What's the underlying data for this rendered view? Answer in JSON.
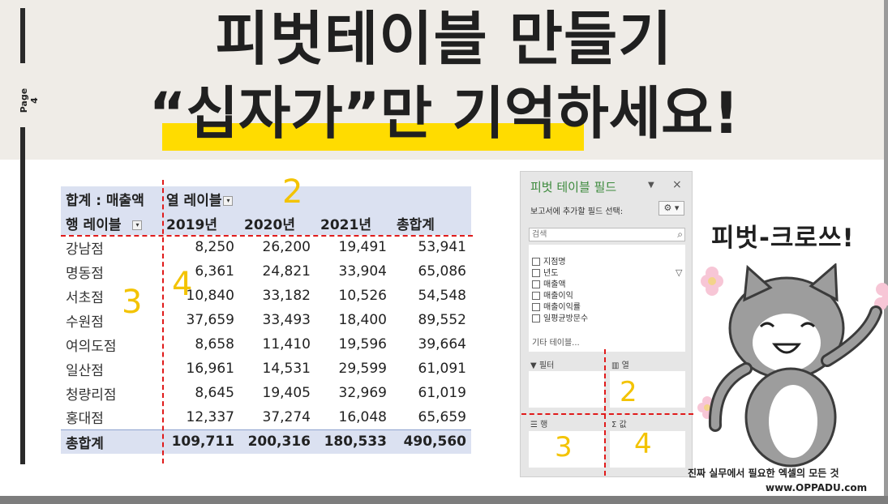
{
  "page": {
    "label": "Page 4"
  },
  "title": {
    "line1": "피벗테이블 만들기",
    "line2": "“십자가”만 기억하세요!"
  },
  "pivot_table": {
    "value_label": "합계 : 매출액",
    "column_label": "열 레이블",
    "row_label": "행 레이블",
    "years": [
      "2019년",
      "2020년",
      "2021년",
      "총합계"
    ],
    "rows": [
      {
        "name": "강남점",
        "values": [
          "8,250",
          "26,200",
          "19,491",
          "53,941"
        ]
      },
      {
        "name": "명동점",
        "values": [
          "6,361",
          "24,821",
          "33,904",
          "65,086"
        ]
      },
      {
        "name": "서초점",
        "values": [
          "10,840",
          "33,182",
          "10,526",
          "54,548"
        ]
      },
      {
        "name": "수원점",
        "values": [
          "37,659",
          "33,493",
          "18,400",
          "89,552"
        ]
      },
      {
        "name": "여의도점",
        "values": [
          "8,658",
          "11,410",
          "19,596",
          "39,664"
        ]
      },
      {
        "name": "일산점",
        "values": [
          "16,961",
          "14,531",
          "29,599",
          "61,091"
        ]
      },
      {
        "name": "청량리점",
        "values": [
          "8,645",
          "19,405",
          "32,969",
          "61,019"
        ]
      },
      {
        "name": "홍대점",
        "values": [
          "12,337",
          "37,274",
          "16,048",
          "65,659"
        ]
      }
    ],
    "total": {
      "name": "총합계",
      "values": [
        "109,711",
        "200,316",
        "180,533",
        "490,560"
      ]
    }
  },
  "annotations": {
    "col_num": "2",
    "row_num": "3",
    "val_num": "4"
  },
  "field_pane": {
    "title": "피벗 테이블 필드",
    "subtitle": "보고서에 추가할 필드 선택:",
    "search_placeholder": "검색",
    "fields": [
      "지점명",
      "년도",
      "매출액",
      "매출이익",
      "매출이익률",
      "일평균방문수"
    ],
    "more_tables": "기타 테이블...",
    "areas": {
      "filter": "필터",
      "columns": "열",
      "rows": "행",
      "values": "값"
    },
    "area_marks": {
      "columns": "2",
      "rows": "3",
      "values": "4"
    }
  },
  "side": {
    "cross_text": "피벗-크로쓰!"
  },
  "footer": {
    "tagline": "진짜 실무에서 필요한 엑셀의 모든 것",
    "url": "www.OPPADU.com"
  },
  "colors": {
    "highlight": "#ffdc00",
    "pivot_header": "#dbe1f1",
    "annotation": "#f3c300",
    "guide_line": "#e01b1b",
    "pane_title": "#3c8a3c"
  }
}
